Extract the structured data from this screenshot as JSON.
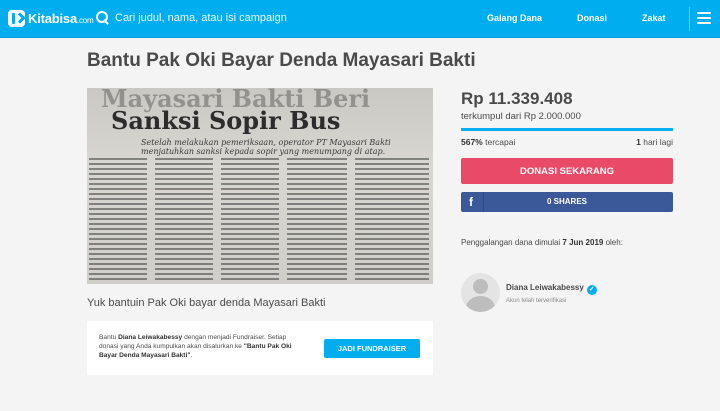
{
  "navbar": {
    "logo_text": "Kitabisa",
    "logo_suffix": ".com",
    "search_placeholder": "Cari judul, nama, atau isi campaign",
    "links": [
      "Galang Dana",
      "Donasi",
      "Zakat"
    ]
  },
  "campaign": {
    "title": "Bantu Pak Oki Bayar Denda Mayasari Bakti",
    "image": {
      "headline_ghost": "Mayasari Bakti Beri",
      "headline": "Sanksi Sopir Bus",
      "deck": "Setelah melakukan pemeriksaan, operator PT Mayasari Bakti menjatuhkan sanksi kepada sopir yang menumpang di atap."
    },
    "caption": "Yuk bantuin Pak Oki bayar denda Mayasari Bakti"
  },
  "fundraiser_card": {
    "text_1": "Bantu ",
    "name": "Diana Leiwakabessy",
    "text_2": " dengan menjadi Fundraiser. Setiap donasi yang Anda kumpulkan akan disalurkan ke ",
    "campaign_quote": "\"Bantu Pak Oki Bayar Denda Mayasari Bakti\"",
    "text_3": ".",
    "button_label": "JADI FUNDRAISER"
  },
  "stats": {
    "amount": "Rp 11.339.408",
    "target": "terkumpul dari Rp 2.000.000",
    "progress_fraction": 1.0,
    "percent_value": "567%",
    "percent_label": " tercapai",
    "days_value": "1",
    "days_label": " hari lagi"
  },
  "actions": {
    "donate_label": "DONASI SEKARANG",
    "share_icon": "f",
    "share_label": "0 SHARES"
  },
  "fund_date": {
    "prefix": "Penggalangan dana dimulai ",
    "date": "7 Jun 2019",
    "suffix": " oleh:"
  },
  "organizer": {
    "name": "Diana Leiwakabessy",
    "status": "Akun telah terverifikasi"
  },
  "colors": {
    "brand": "#00aeef",
    "donate": "#e94a67",
    "facebook": "#3b5998"
  },
  "icons": [
    "logo-icon",
    "search-icon",
    "menu-icon",
    "facebook-icon",
    "verified-icon",
    "avatar-placeholder-icon"
  ]
}
